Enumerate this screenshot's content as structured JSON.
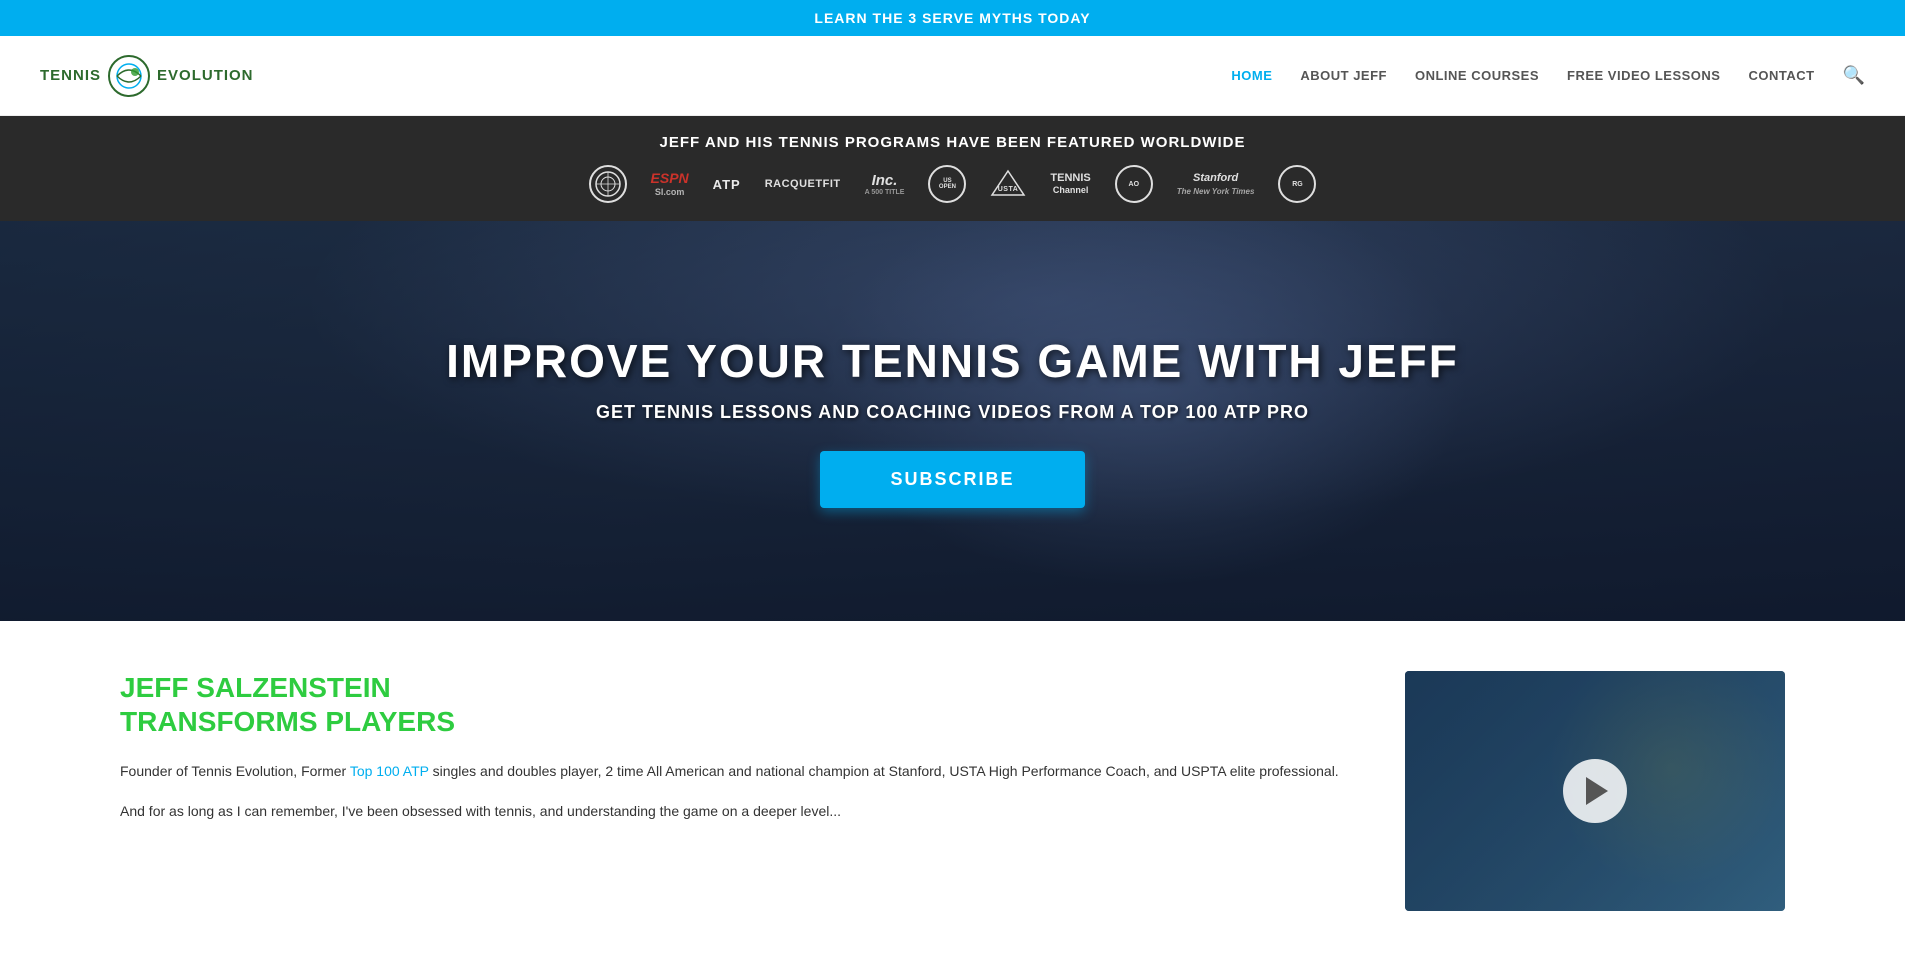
{
  "banner": {
    "text": "LEARN THE 3 SERVE MYTHS TODAY"
  },
  "header": {
    "logo": {
      "tennis": "TENNIS",
      "evolution": "EVOLUTION"
    },
    "nav": {
      "items": [
        {
          "label": "HOME",
          "active": true
        },
        {
          "label": "ABOUT JEFF",
          "active": false
        },
        {
          "label": "ONLINE COURSES",
          "active": false
        },
        {
          "label": "FREE VIDEO LESSONS",
          "active": false
        },
        {
          "label": "CONTACT",
          "active": false
        }
      ]
    }
  },
  "featured": {
    "title": "JEFF AND HIS TENNIS PROGRAMS HAVE BEEN FEATURED WORLDWIDE",
    "logos": [
      "Wimbledon",
      "ESPN / SI.com",
      "ATP",
      "RACQUETFIT",
      "Inc.",
      "US OPEN",
      "USTA",
      "Tennis Channel",
      "Australian Open",
      "Stanford / The New York Times",
      "Roland Garros"
    ]
  },
  "hero": {
    "title": "IMPROVE YOUR TENNIS GAME WITH JEFF",
    "subtitle": "GET TENNIS LESSONS AND COACHING VIDEOS FROM A TOP 100 ATP PRO",
    "cta": "SUBSCRIBE"
  },
  "bio": {
    "title_line1": "JEFF SALZENSTEIN",
    "title_line2": "TRANSFORMS PLAYERS",
    "text1": "Founder of Tennis Evolution, Former Top 100 ATP singles and doubles player, 2 time All American and national champion at Stanford, USTA High Performance Coach, and USPTA elite professional.",
    "text1_highlight": "Top 100 ATP",
    "text2": "And for as long as I can remember, I've been obsessed with tennis, and understanding the game on a deeper level..."
  },
  "video": {
    "play_label": "Play Video"
  },
  "colors": {
    "accent_blue": "#00AEEF",
    "accent_green": "#2ecc40",
    "nav_active": "#00AEEF",
    "dark_bg": "#2a2a2a"
  }
}
